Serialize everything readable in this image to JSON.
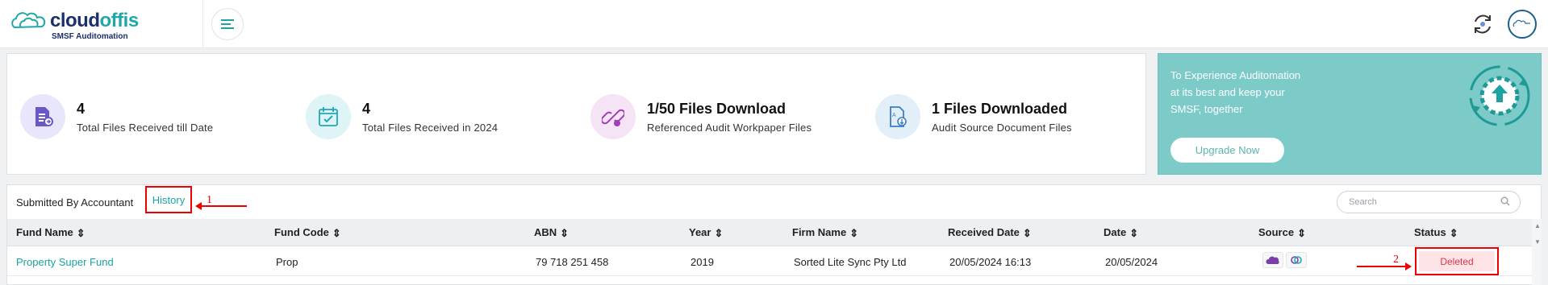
{
  "header": {
    "logo_text_main": "cloud",
    "logo_text_accent": "offis",
    "logo_subtitle": "SMSF Auditomation"
  },
  "stats": [
    {
      "value": "4",
      "label": "Total Files Received till Date",
      "icon": "file-received-icon",
      "color": "#e8e6fb"
    },
    {
      "value": "4",
      "label": "Total Files Received in 2024",
      "icon": "calendar-check-icon",
      "color": "#def4f6"
    },
    {
      "value": "1/50 Files Download",
      "label": "Referenced Audit Workpaper Files",
      "icon": "link-file-icon",
      "color": "#f4e4f6"
    },
    {
      "value": "1 Files Downloaded",
      "label": "Audit Source Document Files",
      "icon": "download-doc-icon",
      "color": "#e2eef8"
    }
  ],
  "promo": {
    "text": "To Experience Auditomation at its best and keep your SMSF, together",
    "button_label": "Upgrade Now"
  },
  "tabs": {
    "submitted": "Submitted By Accountant",
    "history": "History"
  },
  "search": {
    "placeholder": "Search"
  },
  "table": {
    "columns": [
      "Fund Name",
      "Fund Code",
      "ABN",
      "Year",
      "Firm Name",
      "Received Date",
      "Date",
      "Source",
      "Status"
    ],
    "rows": [
      {
        "fund_name": "Property Super Fund",
        "fund_code": "Prop",
        "abn": "79 718 251 458",
        "year": "2019",
        "firm_name": "Sorted Lite Sync Pty Ltd",
        "received_date": "20/05/2024 16:13",
        "date": "20/05/2024",
        "source_icons": [
          "cloud-source-icon",
          "sync-source-icon"
        ],
        "status": "Deleted"
      }
    ]
  },
  "annotations": {
    "one": "1",
    "two": "2"
  },
  "colors": {
    "accent": "#1aa3a0",
    "promo_bg": "#7dcbc9",
    "status_deleted_bg": "#fde3e6",
    "status_deleted_text": "#e1344a",
    "annotation": "#ee0000"
  }
}
